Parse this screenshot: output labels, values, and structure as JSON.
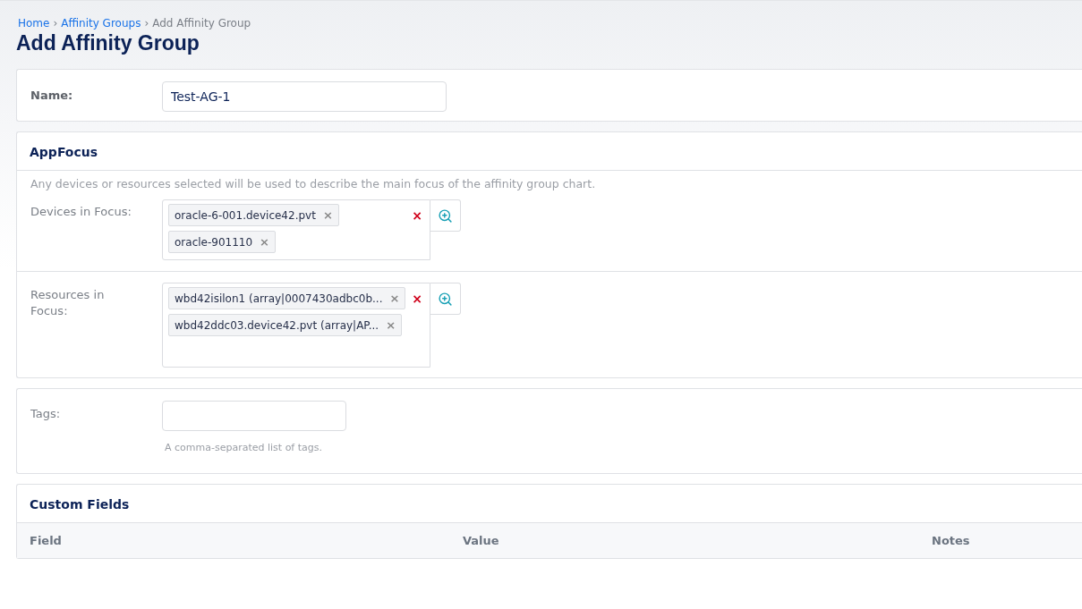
{
  "breadcrumb": [
    {
      "label": "Home",
      "link": true
    },
    {
      "label": "Affinity Groups",
      "link": true
    },
    {
      "label": "Add Affinity Group",
      "link": false
    }
  ],
  "breadcrumb_separator": "›",
  "title": "Add Affinity Group",
  "name_field": {
    "label": "Name:",
    "value": "Test-AG-1"
  },
  "app_focus": {
    "title": "AppFocus",
    "description": "Any devices or resources selected will be used to describe the main focus of the affinity group chart.",
    "pickers": [
      {
        "label": "Devices in Focus:",
        "clear": "×",
        "tokens": [
          {
            "text": "oracle-6-001.device42.pvt",
            "remove": "×"
          },
          {
            "text": "oracle-901110",
            "remove": "×"
          }
        ]
      },
      {
        "label": "Resources in Focus:",
        "clear": "×",
        "tokens": [
          {
            "text": "wbd42isilon1 (array|0007430adbc0b...",
            "remove": "×"
          },
          {
            "text": "wbd42ddc03.device42.pvt (array|AP...",
            "remove": "×"
          }
        ]
      }
    ]
  },
  "tags_field": {
    "label": "Tags:",
    "help": "A comma-separated list of tags."
  },
  "custom_fields": {
    "title": "Custom Fields",
    "columns": [
      "Field",
      "Value",
      "Notes"
    ]
  }
}
